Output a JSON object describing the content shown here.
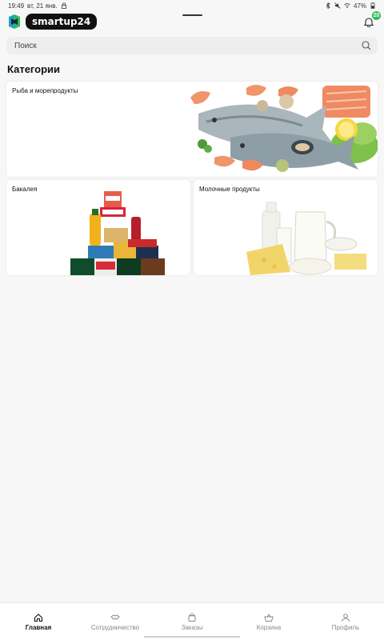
{
  "status_bar": {
    "time": "19:49",
    "date": "вт, 21 янв.",
    "battery": "47%"
  },
  "header": {
    "brand": "smartup24",
    "notification_count": "20"
  },
  "search": {
    "placeholder": "Поиск"
  },
  "categories": {
    "title": "Категории",
    "items": [
      {
        "label": "Рыба и морепродукты"
      },
      {
        "label": "Бакалея"
      },
      {
        "label": "Молочные продукты"
      }
    ]
  },
  "bottom_nav": {
    "items": [
      {
        "label": "Главная",
        "icon": "home-icon",
        "active": true
      },
      {
        "label": "Сотрудничество",
        "icon": "handshake-icon",
        "active": false
      },
      {
        "label": "Заказы",
        "icon": "bag-icon",
        "active": false
      },
      {
        "label": "Корзина",
        "icon": "basket-icon",
        "active": false
      },
      {
        "label": "Профиль",
        "icon": "profile-icon",
        "active": false
      }
    ]
  },
  "colors": {
    "accent": "#2ebd59",
    "brand_pill": "#111111",
    "background": "#f7f7f7"
  }
}
